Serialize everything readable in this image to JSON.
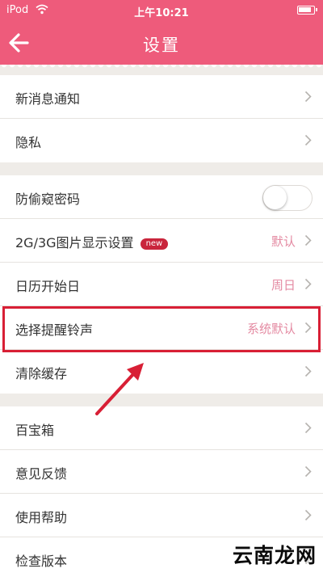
{
  "status_bar": {
    "carrier": "iPod",
    "time": "上午10:21"
  },
  "nav": {
    "title": "设置"
  },
  "groups": [
    {
      "items": [
        {
          "label": "新消息通知"
        },
        {
          "label": "隐私"
        }
      ]
    },
    {
      "items": [
        {
          "label": "防偷窥密码",
          "toggle_on": false
        },
        {
          "label": "2G/3G图片显示设置",
          "badge": "new",
          "value": "默认"
        },
        {
          "label": "日历开始日",
          "value": "周日"
        },
        {
          "label": "选择提醒铃声",
          "value": "系统默认"
        },
        {
          "label": "清除缓存"
        }
      ]
    },
    {
      "items": [
        {
          "label": "百宝箱"
        },
        {
          "label": "意见反馈"
        },
        {
          "label": "使用帮助"
        },
        {
          "label": "检查版本"
        }
      ]
    }
  ],
  "watermark": "云南龙网",
  "colors": {
    "header": "#ee5b7b",
    "value_text": "#e48aa2",
    "badge": "#c9253c",
    "highlight": "#d81f35",
    "background": "#efece8"
  }
}
